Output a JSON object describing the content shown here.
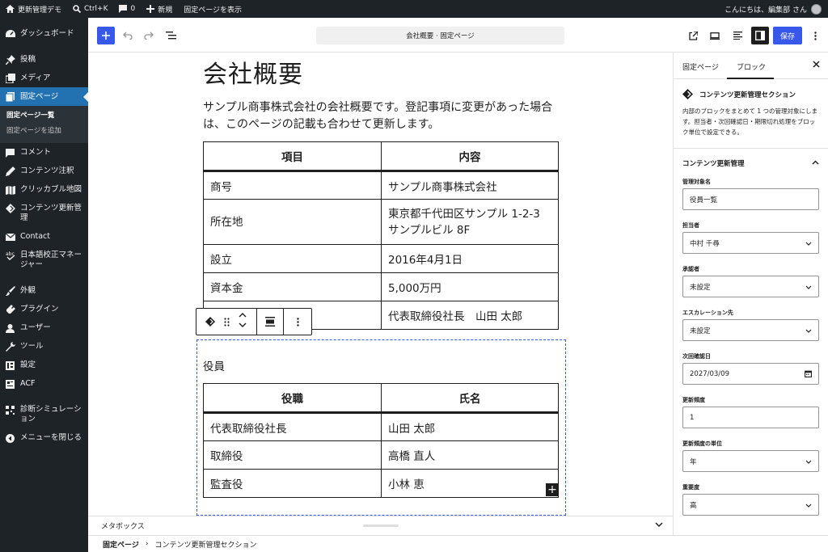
{
  "adminbar": {
    "site_name": "更新管理デモ",
    "search_shortcut": "Ctrl+K",
    "comments_count": "0",
    "new_label": "新規",
    "view_page_label": "固定ページを表示",
    "greeting": "こんにちは、編集部 さん"
  },
  "sidebar": {
    "items": [
      {
        "label": "ダッシュボード",
        "icon": "dashboard-icon"
      },
      {
        "label": "投稿",
        "icon": "pin-icon"
      },
      {
        "label": "メディア",
        "icon": "media-icon"
      },
      {
        "label": "固定ページ",
        "icon": "page-icon"
      },
      {
        "label": "コメント",
        "icon": "comment-icon"
      },
      {
        "label": "コンテンツ注釈",
        "icon": "pen-icon"
      },
      {
        "label": "クリッカブル地図",
        "icon": "map-icon"
      },
      {
        "label": "コンテンツ更新管理",
        "icon": "diamond-icon"
      },
      {
        "label": "Contact",
        "icon": "mail-icon"
      },
      {
        "label": "日本語校正マネージャー",
        "icon": "spellcheck-icon"
      },
      {
        "label": "外観",
        "icon": "brush-icon"
      },
      {
        "label": "プラグイン",
        "icon": "plugin-icon"
      },
      {
        "label": "ユーザー",
        "icon": "user-icon"
      },
      {
        "label": "ツール",
        "icon": "wrench-icon"
      },
      {
        "label": "設定",
        "icon": "settings-icon"
      },
      {
        "label": "ACF",
        "icon": "acf-icon"
      },
      {
        "label": "診断シミュレーション",
        "icon": "qr-icon"
      },
      {
        "label": "メニューを閉じる",
        "icon": "collapse-icon"
      }
    ],
    "submenu": [
      "固定ページ一覧",
      "固定ページを追加"
    ]
  },
  "topbar": {
    "document_title": "会社概要 · 固定ページ",
    "save_label": "保存"
  },
  "content": {
    "title": "会社概要",
    "intro": "サンプル商事株式会社の会社概要です。登記事項に変更があった場合は、このページの記載も合わせて更新します。",
    "company_table": {
      "headers": [
        "項目",
        "内容"
      ],
      "rows": [
        [
          "商号",
          "サンプル商事株式会社"
        ],
        [
          "所在地",
          "東京都千代田区サンプル 1-2-3",
          "サンプルビル 8F"
        ],
        [
          "設立",
          "2016年4月1日"
        ],
        [
          "資本金",
          "5,000万円"
        ],
        [
          "",
          "代表取締役社長　山田 太郎"
        ]
      ]
    },
    "officers_heading": "役員",
    "officers_table": {
      "headers": [
        "役職",
        "氏名"
      ],
      "rows": [
        [
          "代表取締役社長",
          "山田 太郎"
        ],
        [
          "取締役",
          "高橋 直人"
        ],
        [
          "監査役",
          "小林 恵"
        ]
      ]
    }
  },
  "metabox": {
    "label": "メタボックス"
  },
  "footer": {
    "root": "固定ページ",
    "current": "コンテンツ更新管理セクション"
  },
  "inspector": {
    "tab_page": "固定ページ",
    "tab_block": "ブロック",
    "block_title": "コンテンツ更新管理セクション",
    "block_desc": "内部のブロックをまとめて 1 つの管理対象にします。担当者・次回確認日・期限切れ処理をブロック単位で設定できる。",
    "panel_title": "コンテンツ更新管理",
    "fields": [
      {
        "label": "管理対象名",
        "value": "役員一覧",
        "type": "text"
      },
      {
        "label": "担当者",
        "value": "中村 千尋",
        "type": "select"
      },
      {
        "label": "承認者",
        "value": "未設定",
        "type": "select"
      },
      {
        "label": "エスカレーション先",
        "value": "未設定",
        "type": "select"
      },
      {
        "label": "次回確認日",
        "value": "2027/03/09",
        "type": "date"
      },
      {
        "label": "更新頻度",
        "value": "1",
        "type": "text"
      },
      {
        "label": "更新頻度の単位",
        "value": "年",
        "type": "select"
      },
      {
        "label": "重要度",
        "value": "高",
        "type": "select"
      }
    ]
  },
  "colors": {
    "admin_dark": "#1d2327",
    "accent": "#3858e9",
    "menu_current": "#2271b1"
  }
}
